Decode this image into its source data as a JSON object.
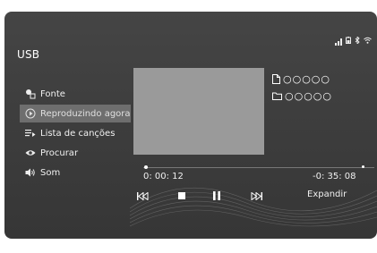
{
  "screen": {
    "title": "USB",
    "accent_colors": {
      "panel": "#3f3f3f",
      "active_item": "#6e6e6e",
      "album_art": "#9a9a9a",
      "text": "#ffffff"
    }
  },
  "status_bar": {
    "icons": [
      "signal-icon",
      "battery-icon",
      "bluetooth-icon",
      "wifi-icon"
    ]
  },
  "menu": {
    "items": [
      {
        "label": "Fonte",
        "icon": "source-icon",
        "active": false
      },
      {
        "label": "Reproduzindo agora",
        "icon": "play-circle-icon",
        "active": true
      },
      {
        "label": "Lista de canções",
        "icon": "playlist-icon",
        "active": false
      },
      {
        "label": "Procurar",
        "icon": "eye-icon",
        "active": false
      },
      {
        "label": "Som",
        "icon": "speaker-icon",
        "active": false
      }
    ]
  },
  "track": {
    "file_name": "○○○○○",
    "folder_name": "○○○○○",
    "elapsed": "0: 00: 12",
    "remaining": "-0: 35: 08",
    "progress": 0.006
  },
  "controls": {
    "expand_label": "Expandir"
  }
}
